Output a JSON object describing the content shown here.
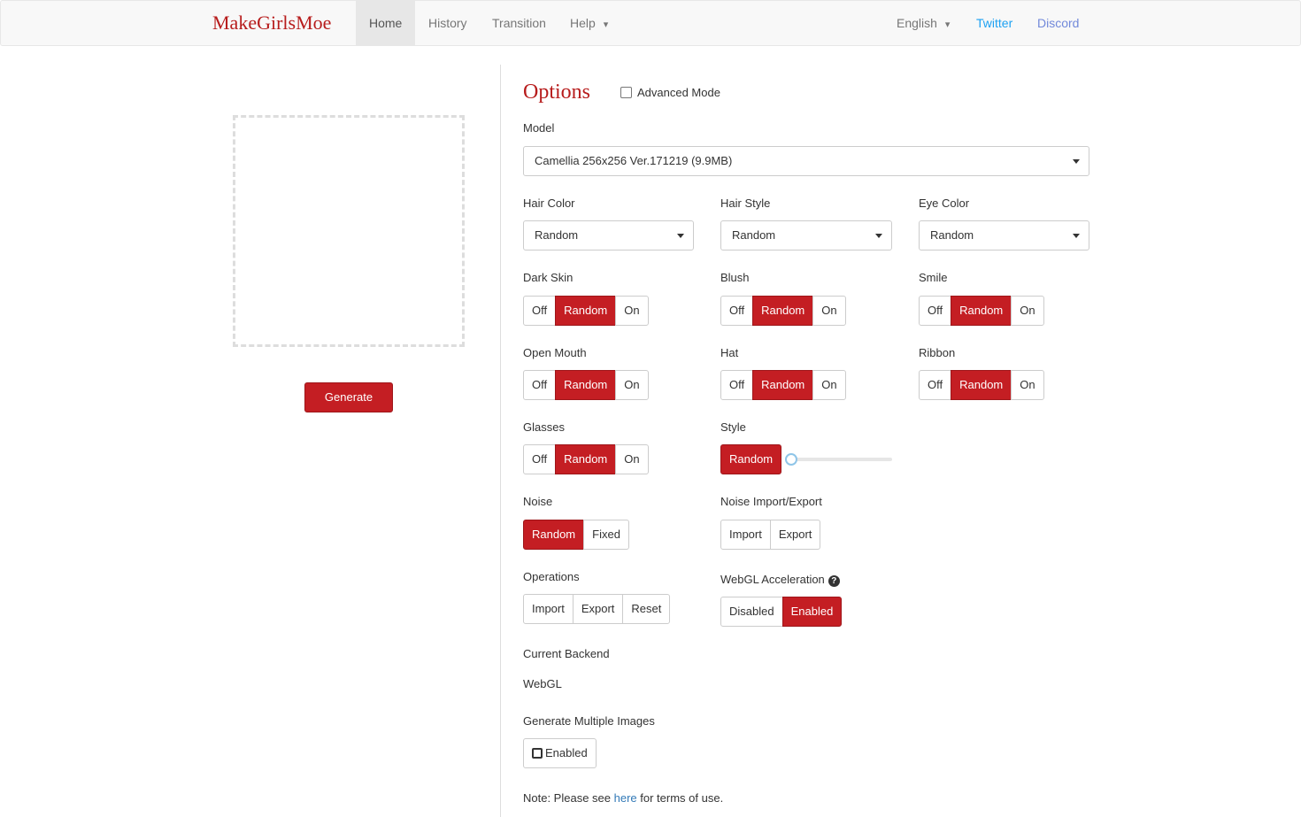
{
  "nav": {
    "brand": "MakeGirlsMoe",
    "items": [
      {
        "label": "Home"
      },
      {
        "label": "History"
      },
      {
        "label": "Transition"
      },
      {
        "label": "Help"
      }
    ],
    "language": "English",
    "twitter": "Twitter",
    "discord": "Discord",
    "caret": "▾"
  },
  "left": {
    "generate_label": "Generate"
  },
  "options": {
    "title": "Options",
    "advanced_label": "Advanced Mode",
    "model_label": "Model",
    "model_value": "Camellia 256x256 Ver.171219 (9.9MB)",
    "hair_color": {
      "label": "Hair Color",
      "value": "Random"
    },
    "hair_style": {
      "label": "Hair Style",
      "value": "Random"
    },
    "eye_color": {
      "label": "Eye Color",
      "value": "Random"
    },
    "toggle_labels": {
      "off": "Off",
      "random": "Random",
      "on": "On"
    },
    "dark_skin": "Dark Skin",
    "blush": "Blush",
    "smile": "Smile",
    "open_mouth": "Open Mouth",
    "hat": "Hat",
    "ribbon": "Ribbon",
    "glasses": "Glasses",
    "style": {
      "label": "Style",
      "button": "Random",
      "slider_value": 0
    },
    "noise": {
      "label": "Noise",
      "random": "Random",
      "fixed": "Fixed"
    },
    "noise_io": {
      "label": "Noise Import/Export",
      "import": "Import",
      "export": "Export"
    },
    "operations": {
      "label": "Operations",
      "import": "Import",
      "export": "Export",
      "reset": "Reset"
    },
    "webgl": {
      "label": "WebGL Acceleration",
      "disabled": "Disabled",
      "enabled": "Enabled",
      "help": "?"
    },
    "backend": {
      "label": "Current Backend",
      "value": "WebGL"
    },
    "multiple": {
      "label": "Generate Multiple Images",
      "enabled": "Enabled"
    },
    "note": {
      "prefix": "Note: Please see ",
      "link": "here",
      "suffix": " for terms of use."
    }
  },
  "colors": {
    "accent": "#c41e23",
    "brand": "#b71c1c",
    "link": "#337ab7"
  }
}
